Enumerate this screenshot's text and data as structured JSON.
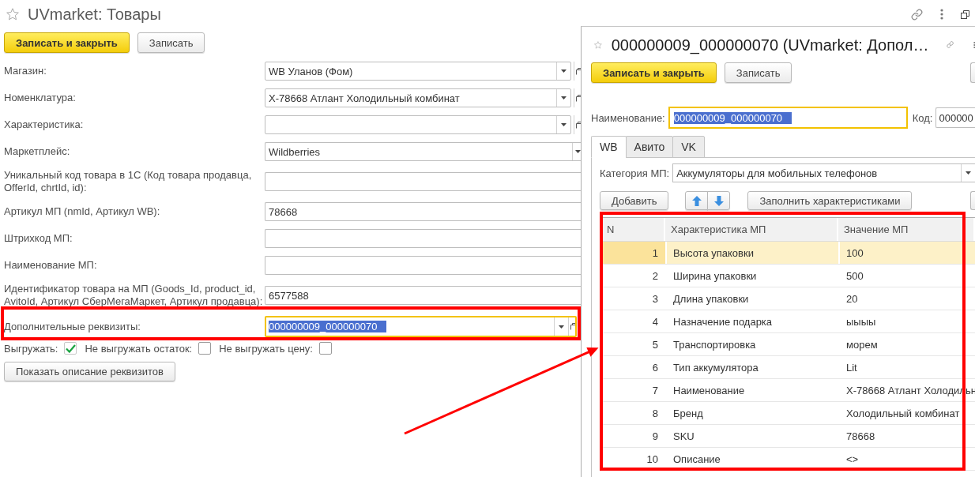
{
  "main_window": {
    "title": "UVmarket: Товары",
    "buttons": [
      {
        "label": "Записать и закрыть",
        "kind": "primary"
      },
      {
        "label": "Записать",
        "kind": "default"
      }
    ],
    "fields": [
      {
        "label": "Магазин:",
        "value": "WB Уланов (Фом)",
        "kind": "reference",
        "focused": false,
        "annotated": false
      },
      {
        "label": "Номенклатура:",
        "value": "Х-78668 Атлант Холодильный комбинат",
        "kind": "reference",
        "focused": false,
        "annotated": false
      },
      {
        "label": "Характеристика:",
        "kind": "reference",
        "focused": false,
        "annotated": false
      },
      {
        "label": "Маркетплейс:",
        "value": "Wildberries",
        "kind": "choice",
        "focused": false,
        "annotated": false
      },
      {
        "label": "Уникальный код товара в 1С (Код товара продавца, OfferId, chrtId, id):",
        "kind": "text",
        "focused": false,
        "annotated": false
      },
      {
        "label": "Артикул МП (nmId, Артикул WB):",
        "value": "78668",
        "kind": "text",
        "focused": false,
        "annotated": false
      },
      {
        "label": "Штрихкод МП:",
        "kind": "text",
        "focused": false,
        "annotated": false
      },
      {
        "label": "Наименование МП:",
        "kind": "text",
        "focused": false,
        "annotated": false
      },
      {
        "label": "Идентификатор товара на МП (Goods_Id, product_id, AvitoId, Артикул СберМегаМаркет, Артикул продавца):",
        "value": "6577588",
        "kind": "text",
        "focused": false,
        "annotated": false
      },
      {
        "label": "Дополнительные реквизиты:",
        "value": "000000009_000000070",
        "kind": "reference",
        "focused": true,
        "annotated": true
      }
    ],
    "checkboxes": [
      {
        "label": "Выгружать:",
        "checked": true
      },
      {
        "label": "Не выгружать остаток:",
        "checked": false
      },
      {
        "label": "Не выгружать цену:",
        "checked": false
      }
    ],
    "describe_button": {
      "label": "Показать описание реквизитов"
    }
  },
  "detail_window": {
    "title": "000000009_000000070 (UVmarket: Допол…",
    "buttons": [
      {
        "label": "Записать и закрыть",
        "kind": "primary"
      },
      {
        "label": "Записать",
        "kind": "default"
      },
      {
        "kind": "cut"
      }
    ],
    "name_field": {
      "label": "Наименование:",
      "value": "000000009_000000070",
      "focused": true
    },
    "code_field": {
      "label": "Код:",
      "value": "000000"
    },
    "tabs": [
      {
        "label": "WB",
        "selected": true
      },
      {
        "label": "Авито",
        "selected": false
      },
      {
        "label": "VK",
        "selected": false
      }
    ],
    "category_field": {
      "label": "Категория МП:",
      "value": "Аккумуляторы для мобильных телефонов"
    },
    "table_buttons": [
      {
        "kind": "text",
        "label": "Добавить"
      },
      {
        "kind": "move_up"
      },
      {
        "kind": "move_down"
      },
      {
        "kind": "text",
        "label": "Заполнить характеристиками"
      },
      {
        "kind": "cut"
      }
    ],
    "table": {
      "annotated": true,
      "columns": [
        "N",
        "Характеристика МП",
        "Значение МП"
      ],
      "rows": [
        {
          "n": "1",
          "name": "Высота упаковки",
          "value": "100",
          "selected": true
        },
        {
          "n": "2",
          "name": "Ширина упаковки",
          "value": "500",
          "selected": false
        },
        {
          "n": "3",
          "name": "Длина упаковки",
          "value": "20",
          "selected": false
        },
        {
          "n": "4",
          "name": "Назначение подарка",
          "value": "ыыыы",
          "selected": false
        },
        {
          "n": "5",
          "name": "Транспортировка",
          "value": "морем",
          "selected": false
        },
        {
          "n": "6",
          "name": "Тип аккумулятора",
          "value": "Lit",
          "selected": false
        },
        {
          "n": "7",
          "name": "Наименование",
          "value": "Х-78668 Атлант Холодильн",
          "selected": false
        },
        {
          "n": "8",
          "name": "Бренд",
          "value": "Холодильный комбинат",
          "selected": false
        },
        {
          "n": "9",
          "name": "SKU",
          "value": "78668",
          "selected": false
        },
        {
          "n": "10",
          "name": "Описание",
          "value": "<>",
          "selected": false
        }
      ]
    }
  },
  "annotation_arrow": true
}
